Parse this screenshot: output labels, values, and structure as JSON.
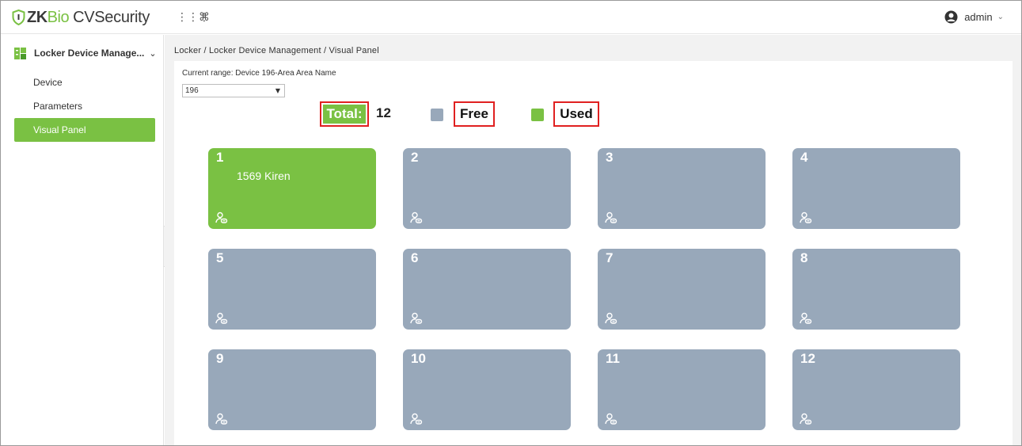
{
  "app": {
    "logo_zk": "ZK",
    "logo_bio": "Bio",
    "logo_rest": "CVSecurity",
    "grid_icon": "apps-grid-icon",
    "cmd_icon": "command-icon",
    "user": "admin"
  },
  "sidebar": {
    "module_label": "Locker Device Manage...",
    "items": [
      {
        "label": "Device"
      },
      {
        "label": "Parameters"
      },
      {
        "label": "Visual Panel"
      }
    ],
    "collapse_icon": "«"
  },
  "main": {
    "breadcrumb": "Locker / Locker Device Management / Visual Panel",
    "range_label": "Current range: Device 196-Area Area Name",
    "device_select_value": "196"
  },
  "legend": {
    "total_label": "Total:",
    "total_count": "12",
    "free_label": "Free",
    "used_label": "Used"
  },
  "colors": {
    "accent_green": "#7ac143",
    "free_gray": "#98a8ba",
    "highlight_red": "#e02020"
  },
  "lockers": [
    {
      "number": "1",
      "status": "used",
      "user": "1569 Kiren"
    },
    {
      "number": "2",
      "status": "free",
      "user": ""
    },
    {
      "number": "3",
      "status": "free",
      "user": ""
    },
    {
      "number": "4",
      "status": "free",
      "user": ""
    },
    {
      "number": "5",
      "status": "free",
      "user": ""
    },
    {
      "number": "6",
      "status": "free",
      "user": ""
    },
    {
      "number": "7",
      "status": "free",
      "user": ""
    },
    {
      "number": "8",
      "status": "free",
      "user": ""
    },
    {
      "number": "9",
      "status": "free",
      "user": ""
    },
    {
      "number": "10",
      "status": "free",
      "user": ""
    },
    {
      "number": "11",
      "status": "free",
      "user": ""
    },
    {
      "number": "12",
      "status": "free",
      "user": ""
    }
  ]
}
